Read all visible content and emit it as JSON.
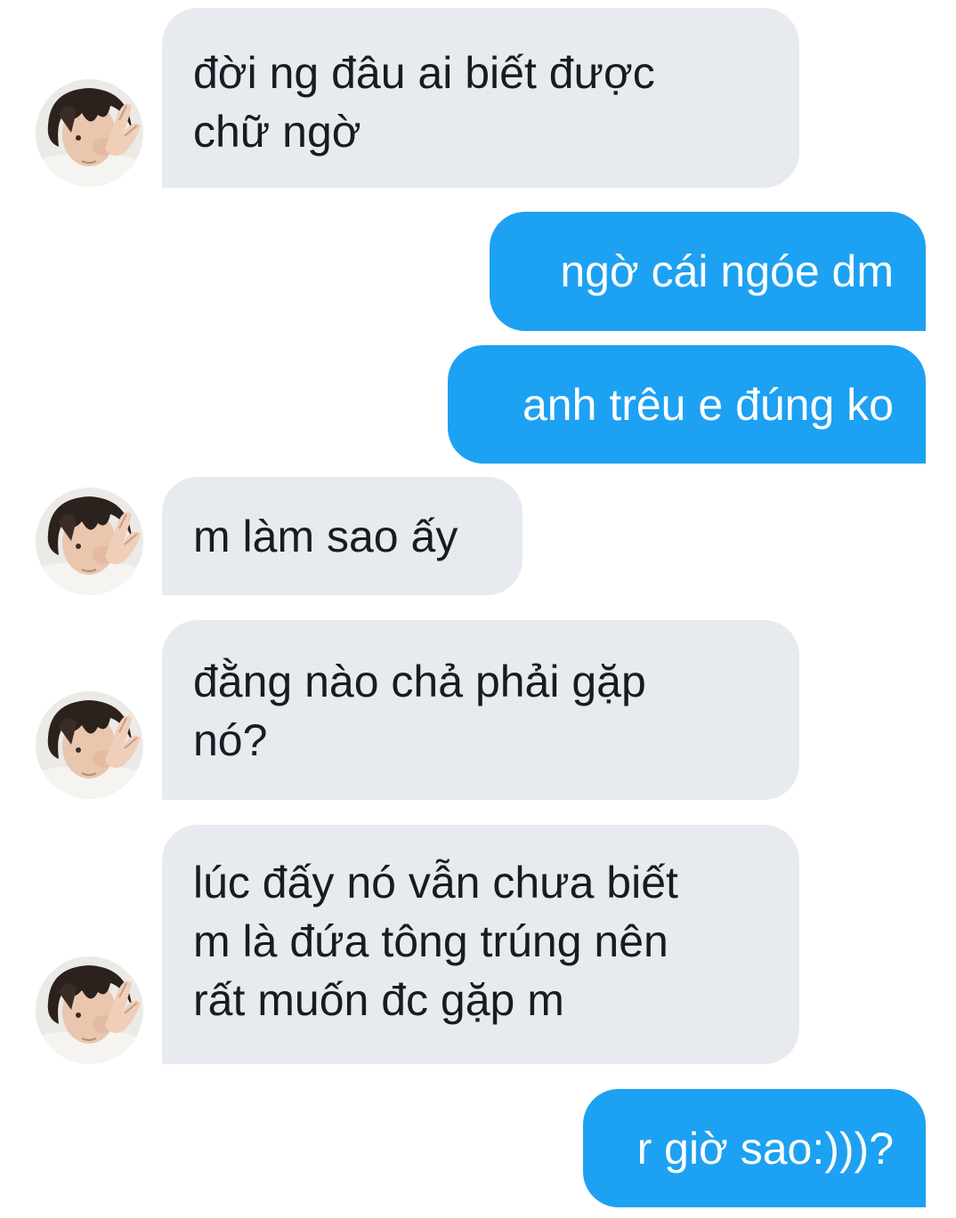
{
  "messages": [
    {
      "direction": "incoming",
      "text": "đời ng đâu ai biết được chữ ngờ",
      "lines": [
        "đời ng đâu ai biết được",
        "chữ ngờ"
      ]
    },
    {
      "direction": "outgoing",
      "text": "ngờ cái ngóe dm"
    },
    {
      "direction": "outgoing",
      "text": "anh trêu e đúng ko"
    },
    {
      "direction": "incoming",
      "text": "m làm sao ấy",
      "lines": [
        "m làm sao ấy"
      ]
    },
    {
      "direction": "incoming",
      "text": "đằng nào chả phải gặp nó?",
      "lines": [
        "đằng nào chả phải gặp",
        "nó?"
      ]
    },
    {
      "direction": "incoming",
      "text": "lúc đấy nó vẫn chưa biết m là đứa tông trúng nên rất muốn đc gặp m",
      "lines": [
        "lúc đấy nó vẫn chưa biết",
        "m là đứa tông trúng nên",
        "rất muốn đc gặp m"
      ]
    },
    {
      "direction": "outgoing",
      "text": "r giờ sao:)))?"
    }
  ],
  "colors": {
    "incoming_bubble": "#e7eaef",
    "incoming_text": "#181c22",
    "outgoing_bubble": "#1da1f2",
    "outgoing_text": "#ffffff",
    "background": "#ffffff"
  },
  "avatar_icon": "person-peace-sign-avatar"
}
